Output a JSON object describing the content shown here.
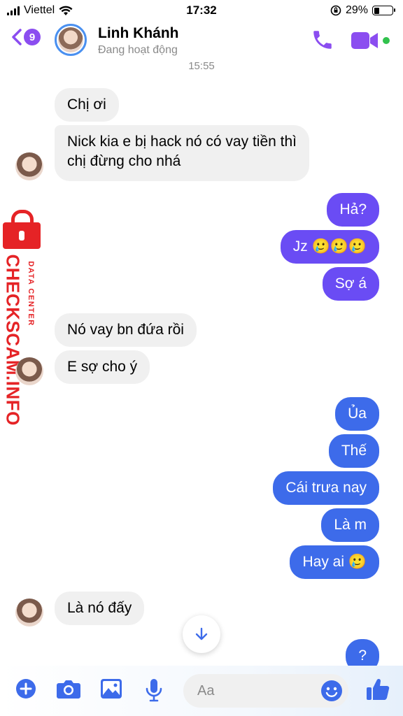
{
  "status_bar": {
    "carrier": "Viettel",
    "time": "17:32",
    "battery_percent": "29%"
  },
  "header": {
    "back_badge_count": "9",
    "contact_name": "Linh Khánh",
    "contact_status": "Đang hoạt động"
  },
  "conversation": {
    "timestamp": "15:55",
    "messages": [
      {
        "side": "in",
        "text": "Chị ơi"
      },
      {
        "side": "in",
        "text": "Nick kia e bị hack nó có vay tiền thì"
      },
      {
        "side": "in",
        "text": "chị đừng cho nhá"
      },
      {
        "side": "out",
        "text": "Hả?"
      },
      {
        "side": "out",
        "text": "Jz 🥲🥲🥲"
      },
      {
        "side": "out",
        "text": "Sợ á"
      },
      {
        "side": "in",
        "text": "Nó vay bn đứa rồi"
      },
      {
        "side": "in",
        "text": "E sợ cho ý"
      },
      {
        "side": "out",
        "text": "Ủa"
      },
      {
        "side": "out",
        "text": "Thế"
      },
      {
        "side": "out",
        "text": "Cái trưa nay"
      },
      {
        "side": "out",
        "text": "Là m"
      },
      {
        "side": "out",
        "text": "Hay ai 🥲"
      },
      {
        "side": "in",
        "text": "Là nó đấy"
      },
      {
        "side": "out",
        "text": "?"
      }
    ]
  },
  "watermark": {
    "main_text": "CHECKSCAM.INFO",
    "sub_text": "DATA CENTER"
  },
  "composer": {
    "placeholder": "Aa"
  },
  "colors": {
    "outgoing_purple": "#6a4cf4",
    "outgoing_blue": "#3d6bea",
    "incoming_bg": "#f0f0f0",
    "accent": "#8b4df0",
    "online": "#31c24d",
    "watermark_red": "#e52326"
  },
  "icons": {
    "composer": [
      "plus-icon",
      "camera-icon",
      "image-icon",
      "microphone-icon",
      "emoji-icon",
      "thumbs-up-icon"
    ],
    "header": [
      "back-chevron-icon",
      "phone-icon",
      "video-camera-icon"
    ]
  }
}
